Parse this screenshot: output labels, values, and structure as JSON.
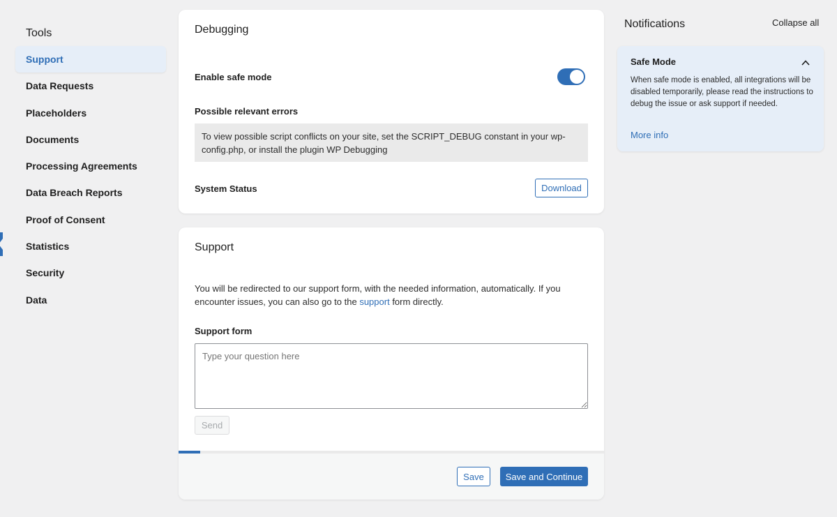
{
  "sidebar": {
    "title": "Tools",
    "items": [
      {
        "label": "Support",
        "active": true
      },
      {
        "label": "Data Requests"
      },
      {
        "label": "Placeholders"
      },
      {
        "label": "Documents"
      },
      {
        "label": "Processing Agreements"
      },
      {
        "label": "Data Breach Reports"
      },
      {
        "label": "Proof of Consent"
      },
      {
        "label": "Statistics"
      },
      {
        "label": "Security"
      },
      {
        "label": "Data"
      }
    ]
  },
  "debugging": {
    "title": "Debugging",
    "safe_mode_label": "Enable safe mode",
    "safe_mode_enabled": true,
    "errors_label": "Possible relevant errors",
    "errors_text": "To view possible script conflicts on your site, set the SCRIPT_DEBUG constant in your wp-config.php, or install the plugin WP Debugging",
    "system_status_label": "System Status",
    "download_label": "Download"
  },
  "support": {
    "title": "Support",
    "intro_before": "You will be redirected to our support form, with the needed information, automatically. If you encounter issues, you can also go to the ",
    "intro_link": "support",
    "intro_after": " form directly.",
    "form_label": "Support form",
    "textarea_placeholder": "Type your question here",
    "send_label": "Send"
  },
  "footer": {
    "progress_percent": 5,
    "save_label": "Save",
    "save_continue_label": "Save and Continue"
  },
  "notifications": {
    "title": "Notifications",
    "collapse_all": "Collapse all",
    "items": [
      {
        "title": "Safe Mode",
        "text": "When safe mode is enabled, all integrations will be disabled temporarily, please read the instructions to debug the issue or ask support if needed.",
        "link": "More info"
      }
    ]
  },
  "colors": {
    "accent": "#2f6eb6",
    "active_bg": "#e6eef8",
    "page_bg": "#f0f0f1"
  }
}
